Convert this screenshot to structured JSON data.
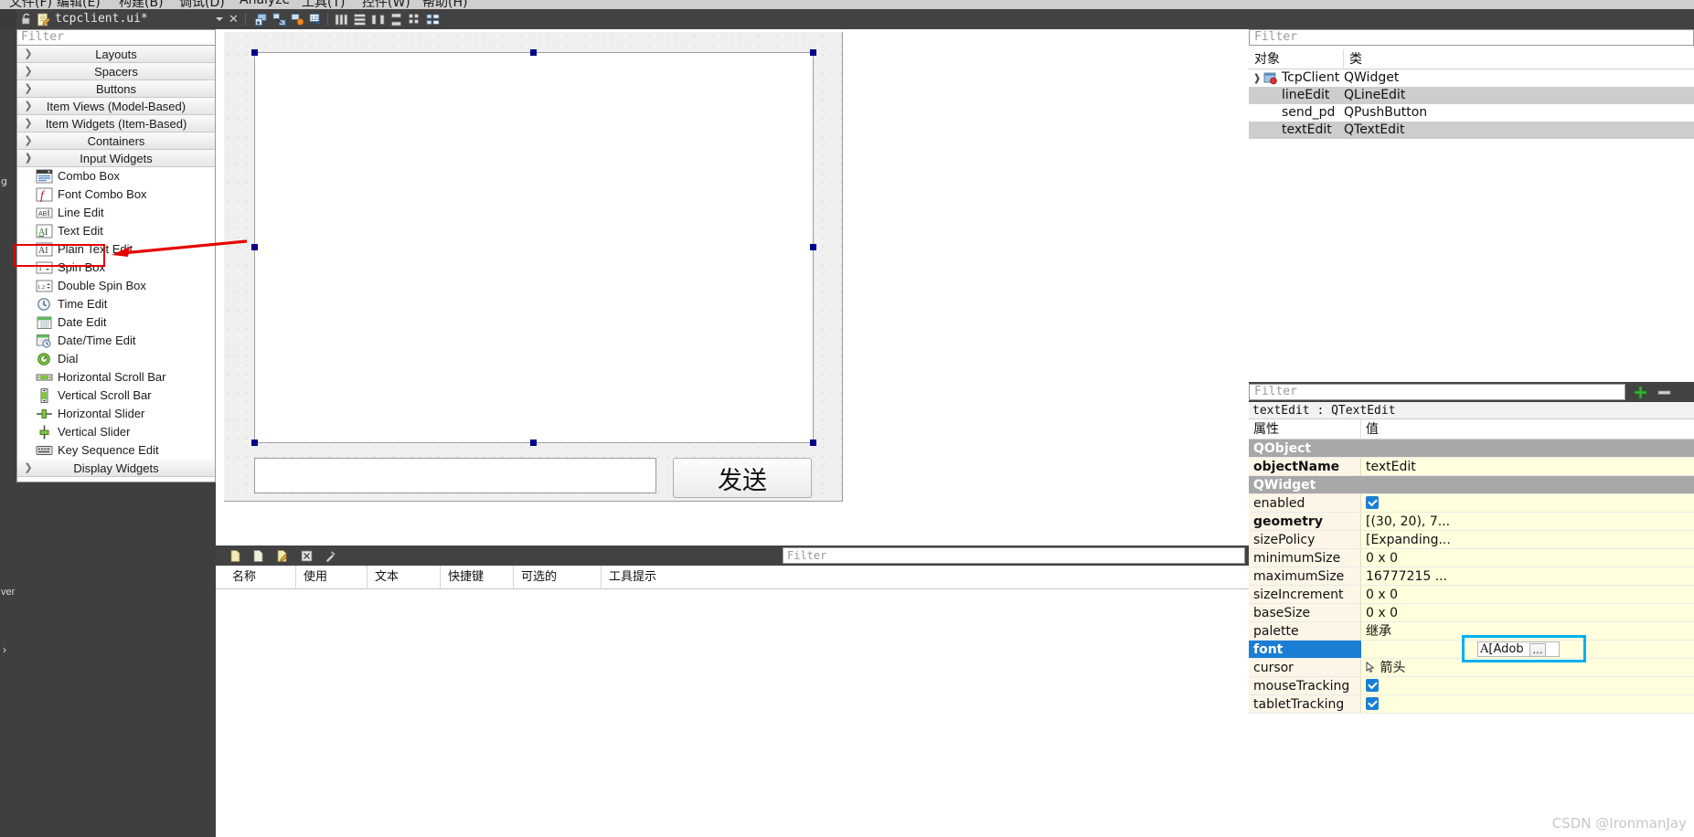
{
  "menubar": {
    "items": [
      "文件(F)",
      "编辑(E)",
      "构建(B)",
      "调试(D)",
      "Analyze",
      "工具(T)",
      "控件(W)",
      "帮助(H)"
    ]
  },
  "toolbar": {
    "file_tab": "tcpclient.ui*",
    "lock_icon": "unlock-icon",
    "file_icon": "ui-file-icon",
    "close_icon": "✕",
    "caret_icon": "chevron-down-icon",
    "buttons": [
      {
        "name": "edit-widgets-icon"
      },
      {
        "name": "edit-signals-slots-icon"
      },
      {
        "name": "edit-buddies-icon"
      },
      {
        "name": "edit-tab-order-icon"
      },
      {
        "name": "layout-horizontally-icon"
      },
      {
        "name": "layout-vertically-icon"
      },
      {
        "name": "layout-splitter-horizontal-icon"
      },
      {
        "name": "layout-splitter-vertical-icon"
      },
      {
        "name": "layout-grid-icon"
      }
    ]
  },
  "widget_box": {
    "filter_placeholder": "Filter",
    "categories": [
      {
        "label": "Layouts",
        "expanded": false
      },
      {
        "label": "Spacers",
        "expanded": false
      },
      {
        "label": "Buttons",
        "expanded": false
      },
      {
        "label": "Item Views (Model-Based)",
        "expanded": false
      },
      {
        "label": "Item Widgets (Item-Based)",
        "expanded": false
      },
      {
        "label": "Containers",
        "expanded": false
      },
      {
        "label": "Input Widgets",
        "expanded": true
      },
      {
        "label": "Display Widgets",
        "expanded": false
      }
    ],
    "input_widgets": [
      {
        "label": "Combo Box",
        "icon": "combobox-icon"
      },
      {
        "label": "Font Combo Box",
        "icon": "fontcombobox-icon"
      },
      {
        "label": "Line Edit",
        "icon": "lineedit-icon"
      },
      {
        "label": "Text Edit",
        "icon": "textedit-icon",
        "highlighted": true
      },
      {
        "label": "Plain Text Edit",
        "icon": "plaintextedit-icon"
      },
      {
        "label": "Spin Box",
        "icon": "spinbox-icon"
      },
      {
        "label": "Double Spin Box",
        "icon": "doublespinbox-icon"
      },
      {
        "label": "Time Edit",
        "icon": "timeedit-icon"
      },
      {
        "label": "Date Edit",
        "icon": "dateedit-icon"
      },
      {
        "label": "Date/Time Edit",
        "icon": "datetimeedit-icon"
      },
      {
        "label": "Dial",
        "icon": "dial-icon"
      },
      {
        "label": "Horizontal Scroll Bar",
        "icon": "hscrollbar-icon"
      },
      {
        "label": "Vertical Scroll Bar",
        "icon": "vscrollbar-icon"
      },
      {
        "label": "Horizontal Slider",
        "icon": "hslider-icon"
      },
      {
        "label": "Vertical Slider",
        "icon": "vslider-icon"
      },
      {
        "label": "Key Sequence Edit",
        "icon": "keysequenceedit-icon"
      }
    ],
    "rail_labels": {
      "top": "g",
      "bottom1": "ver",
      "bottom2": "›"
    }
  },
  "canvas": {
    "text_edit": {
      "name": "textEdit",
      "selected": true
    },
    "line_edit": {
      "name": "lineEdit"
    },
    "push_button": {
      "name": "send_pd",
      "label": "发送"
    }
  },
  "action_editor": {
    "filter_placeholder": "Filter",
    "toolbar_icons": [
      {
        "name": "new-action-icon"
      },
      {
        "name": "copy-action-icon"
      },
      {
        "name": "edit-action-icon"
      },
      {
        "name": "delete-action-icon"
      },
      {
        "name": "configure-action-icon"
      }
    ],
    "columns": [
      "名称",
      "使用",
      "文本",
      "快捷键",
      "可选的",
      "工具提示"
    ],
    "rows": []
  },
  "object_inspector": {
    "filter_placeholder": "Filter",
    "columns": [
      "对象",
      "类"
    ],
    "rows": [
      {
        "name": "TcpClient",
        "class": "QWidget",
        "depth": 0,
        "selected": false,
        "expanded": true,
        "icon": "widget-icon"
      },
      {
        "name": "lineEdit",
        "class": "QLineEdit",
        "depth": 1,
        "selected": true
      },
      {
        "name": "send_pd",
        "class": "QPushButton",
        "depth": 1,
        "selected": false
      },
      {
        "name": "textEdit",
        "class": "QTextEdit",
        "depth": 1,
        "selected": true
      }
    ]
  },
  "property_editor": {
    "filter_placeholder": "Filter",
    "add_icon": "plus-icon",
    "remove_icon": "minus-icon",
    "title": "textEdit : QTextEdit",
    "columns": [
      "属性",
      "值"
    ],
    "rows": [
      {
        "kind": "group",
        "name": "QObject"
      },
      {
        "kind": "prop",
        "name": "objectName",
        "value": "textEdit",
        "bold": true
      },
      {
        "kind": "group",
        "name": "QWidget"
      },
      {
        "kind": "prop",
        "name": "enabled",
        "value": "",
        "checkbox": true
      },
      {
        "kind": "prop",
        "name": "geometry",
        "value": "[(30, 20), 7...",
        "bold": true
      },
      {
        "kind": "prop",
        "name": "sizePolicy",
        "value": "[Expanding..."
      },
      {
        "kind": "prop",
        "name": "minimumSize",
        "value": "0 x 0"
      },
      {
        "kind": "prop",
        "name": "maximumSize",
        "value": "16777215 ..."
      },
      {
        "kind": "prop",
        "name": "sizeIncrement",
        "value": "0 x 0"
      },
      {
        "kind": "prop",
        "name": "baseSize",
        "value": "0 x 0"
      },
      {
        "kind": "prop",
        "name": "palette",
        "value": "继承"
      },
      {
        "kind": "prop",
        "name": "font",
        "value": "[Adob",
        "selected": true,
        "fontbtn": true
      },
      {
        "kind": "prop",
        "name": "cursor",
        "value": "箭头",
        "cursoricon": true
      },
      {
        "kind": "prop",
        "name": "mouseTracking",
        "value": "",
        "checkbox": true
      },
      {
        "kind": "prop",
        "name": "tabletTracking",
        "value": "",
        "checkbox": true
      }
    ]
  },
  "watermark": "CSDN @IronmanJay",
  "colors": {
    "chrome_dark": "#424242",
    "accent_blue": "#1a7fd4",
    "annotation_red": "#e60000",
    "annotation_cyan": "#00b0f0",
    "prop_name_bg": "#fdf5e6",
    "prop_value_bg": "#ffffdd"
  }
}
